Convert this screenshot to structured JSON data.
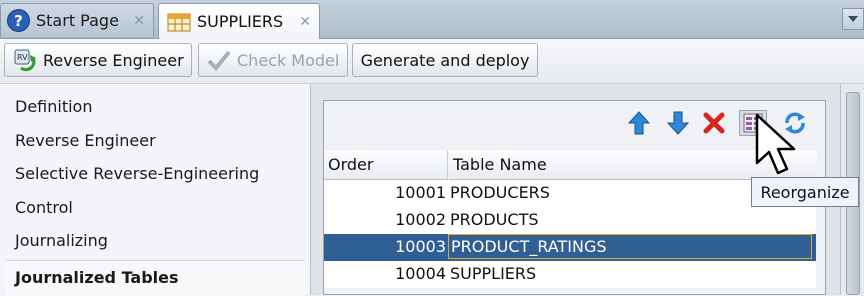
{
  "tabs": [
    {
      "label": "Start Page",
      "icon": "help-icon",
      "active": false
    },
    {
      "label": "SUPPLIERS",
      "icon": "table-icon",
      "active": true
    }
  ],
  "toolbar": {
    "reverse_engineer": "Reverse Engineer",
    "check_model": "Check Model",
    "generate_deploy": "Generate and deploy"
  },
  "nav": {
    "items": [
      "Definition",
      "Reverse Engineer",
      "Selective Reverse-Engineering",
      "Control",
      "Journalizing",
      "Journalized Tables"
    ],
    "active": "Journalized Tables"
  },
  "grid": {
    "tools": [
      "move-up-icon",
      "move-down-icon",
      "delete-icon",
      "reorganize-icon",
      "refresh-icon"
    ],
    "columns": [
      "Order",
      "Table Name"
    ],
    "rows": [
      {
        "order": "10001",
        "name": "PRODUCERS"
      },
      {
        "order": "10002",
        "name": "PRODUCTS"
      },
      {
        "order": "10003",
        "name": "PRODUCT_RATINGS"
      },
      {
        "order": "10004",
        "name": "SUPPLIERS"
      }
    ],
    "selected_row": 2
  },
  "tooltip": "Reorganize",
  "colors": {
    "selection": "#2f5f94",
    "accent": "#2c5fb8"
  }
}
